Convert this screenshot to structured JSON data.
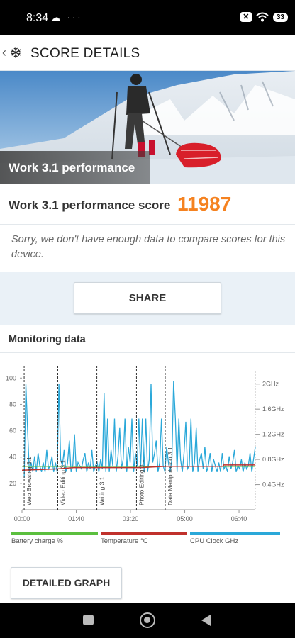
{
  "status_bar": {
    "time": "8:34",
    "left_icons": "☁ ···",
    "battery": "33"
  },
  "app_bar": {
    "back_glyph": "‹",
    "logo_glyph": "❄",
    "title": "SCORE DETAILS"
  },
  "hero": {
    "label": "Work 3.1 performance",
    "version": "3.1"
  },
  "score": {
    "label": "Work 3.1 performance score",
    "value": "11987",
    "note": "Sorry, we don't have enough data to compare scores for this device."
  },
  "share_label": "SHARE",
  "monitoring": {
    "title": "Monitoring data"
  },
  "detail_button_label": "DETAILED GRAPH",
  "colors": {
    "accent_orange": "#f58220",
    "battery": "#5bbf3e",
    "temperature": "#c0312c",
    "cpu": "#2aa8d9"
  },
  "chart_data": {
    "type": "line",
    "x_unit": "mm:ss",
    "x_ticks": [
      "00:00",
      "01:40",
      "03:20",
      "05:00",
      "06:40"
    ],
    "y_left_ticks": [
      "20",
      "40",
      "60",
      "80",
      "100"
    ],
    "y_left_lim": [
      0,
      105
    ],
    "y_right_ticks": [
      "0.4GHz",
      "0.8GHz",
      "1.2GHz",
      "1.6GHz",
      "2GHz"
    ],
    "y_right_lim": [
      0,
      2.2
    ],
    "x_lim_seconds": [
      0,
      430
    ],
    "phases": [
      {
        "label": "Web Browsing 3.1",
        "start_s": 4
      },
      {
        "label": "Video Editing 3.1",
        "start_s": 66
      },
      {
        "label": "Writing 3.1",
        "start_s": 138
      },
      {
        "label": "Photo Editing 3.1",
        "start_s": 211
      },
      {
        "label": "Data Manipulation 3.1",
        "start_s": 264
      }
    ],
    "series": [
      {
        "name": "Battery charge %",
        "axis": "left",
        "points": [
          [
            0,
            33
          ],
          [
            430,
            33
          ]
        ]
      },
      {
        "name": "Temperature °C",
        "axis": "left",
        "points": [
          [
            0,
            30
          ],
          [
            66,
            31
          ],
          [
            95,
            32
          ],
          [
            220,
            32
          ],
          [
            265,
            33
          ],
          [
            370,
            33
          ],
          [
            372,
            34
          ],
          [
            430,
            34
          ]
        ]
      },
      {
        "name": "CPU Clock GHz",
        "axis": "right",
        "values": [
          0.5,
          2.0,
          1.25,
          0.6,
          0.75,
          0.6,
          0.85,
          0.6,
          0.9,
          0.7,
          0.6,
          0.75,
          0.6,
          0.95,
          0.65,
          0.7,
          0.85,
          0.6,
          0.75,
          0.6,
          2.0,
          0.8,
          0.7,
          0.95,
          0.6,
          0.75,
          1.1,
          0.6,
          0.7,
          1.2,
          0.6,
          0.75,
          0.7,
          0.65,
          0.8,
          0.9,
          0.6,
          0.75,
          0.65,
          0.95,
          0.6,
          0.7,
          0.75,
          0.6,
          0.8,
          0.65,
          1.85,
          0.6,
          1.45,
          0.6,
          0.95,
          0.7,
          1.45,
          0.6,
          0.85,
          1.3,
          0.65,
          0.8,
          1.45,
          0.6,
          1.0,
          0.75,
          1.45,
          0.6,
          0.9,
          0.7,
          1.45,
          0.65,
          1.45,
          0.6,
          1.45,
          0.6,
          0.8,
          2.0,
          0.75,
          0.9,
          1.1,
          0.6,
          0.75,
          1.45,
          0.7,
          0.6,
          1.0,
          0.75,
          0.6,
          0.8,
          2.05,
          1.45,
          0.6,
          1.45,
          0.8,
          0.6,
          0.9,
          1.4,
          0.65,
          0.7,
          1.45,
          0.6,
          0.75,
          1.3,
          0.6,
          0.8,
          0.9,
          0.65,
          1.0,
          0.6,
          0.7,
          0.9,
          0.6,
          0.8,
          0.7,
          0.6,
          0.75,
          0.6,
          0.9,
          0.65,
          0.7,
          0.6,
          0.85,
          0.65,
          0.75,
          0.95,
          0.6,
          0.7,
          0.65,
          0.8,
          0.6,
          0.75,
          0.65,
          0.7,
          0.9,
          0.6,
          0.8,
          1.0
        ]
      }
    ],
    "legend": [
      "Battery charge %",
      "Temperature °C",
      "CPU Clock GHz"
    ],
    "legend_position": "bottom"
  }
}
